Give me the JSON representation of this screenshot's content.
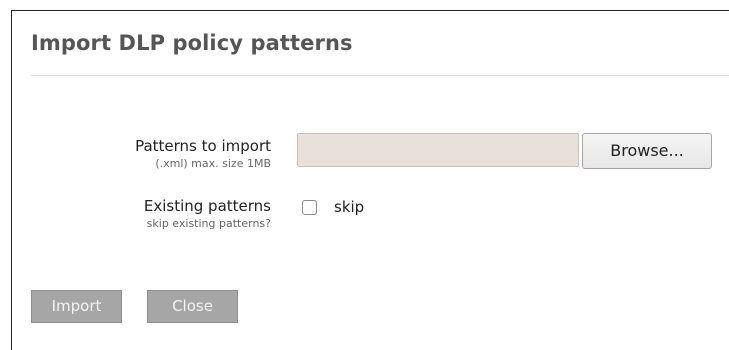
{
  "dialog": {
    "title": "Import DLP policy patterns"
  },
  "form": {
    "patterns": {
      "label": "Patterns to import",
      "hint": "(.xml) max. size 1MB",
      "file_value": "",
      "browse_label": "Browse..."
    },
    "existing": {
      "label": "Existing patterns",
      "hint": "skip existing patterns?",
      "checkbox_label": "skip",
      "checked": false
    }
  },
  "actions": {
    "import_label": "Import",
    "close_label": "Close"
  },
  "colors": {
    "title_text": "#555555",
    "input_background": "#e8e0da",
    "disabled_button": "#a6a6a6"
  }
}
